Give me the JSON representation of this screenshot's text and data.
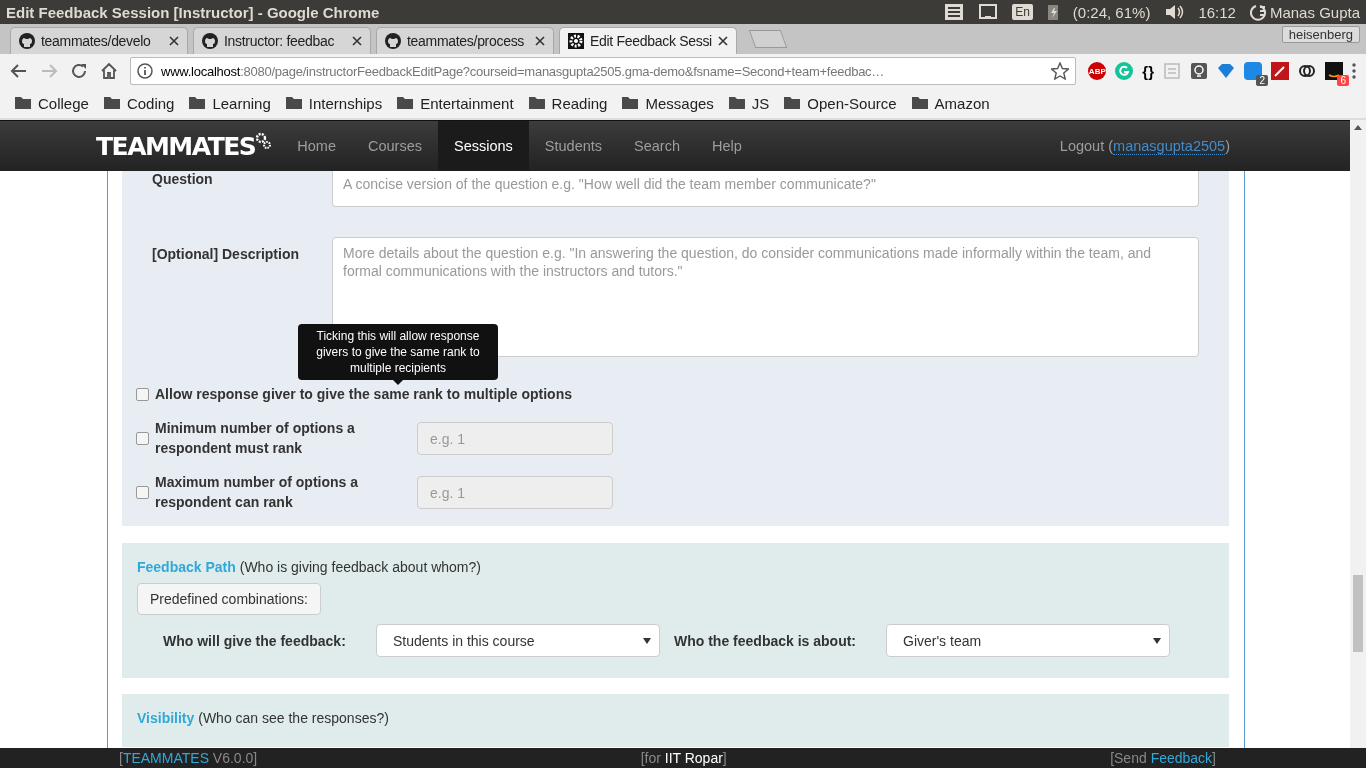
{
  "os_bar": {
    "title": "Edit Feedback Session [Instructor] - Google Chrome",
    "keyboard": "En",
    "battery": "(0:24, 61%)",
    "time": "16:12",
    "user": "Manas Gupta"
  },
  "tabs": [
    {
      "label": "teammates/develo",
      "kind": "github",
      "selected": false
    },
    {
      "label": "Instructor: feedbac",
      "kind": "github",
      "selected": false
    },
    {
      "label": "teammates/process",
      "kind": "github",
      "selected": false
    },
    {
      "label": "Edit Feedback Sessi",
      "kind": "gear",
      "selected": true
    }
  ],
  "profile": "heisenberg",
  "address": {
    "host": "www.localhost",
    "rest": ":8080/page/instructorFeedbackEditPage?courseid=manasgupta2505.gma-demo&fsname=Second+team+feedbac…"
  },
  "extensions": [
    {
      "kind": "abp",
      "label": "ABP"
    },
    {
      "kind": "grammarly"
    },
    {
      "kind": "braces",
      "label": "{}"
    },
    {
      "kind": "reader"
    },
    {
      "kind": "bulb"
    },
    {
      "kind": "diamond"
    },
    {
      "kind": "skype",
      "badge": "2"
    },
    {
      "kind": "wand"
    },
    {
      "kind": "link"
    },
    {
      "kind": "amazon",
      "badge": "6"
    }
  ],
  "bookmarks": [
    "College",
    "Coding",
    "Learning",
    "Internships",
    "Entertainment",
    "Reading",
    "Messages",
    "JS",
    "Open-Source",
    "Amazon"
  ],
  "navbar": {
    "brand": "TEAMMATES",
    "items": [
      {
        "label": "Home",
        "selected": false
      },
      {
        "label": "Courses",
        "selected": false
      },
      {
        "label": "Sessions",
        "selected": true
      },
      {
        "label": "Students",
        "selected": false
      },
      {
        "label": "Search",
        "selected": false
      },
      {
        "label": "Help",
        "selected": false
      }
    ],
    "logout": "Logout (",
    "user": "manasgupta2505",
    "close": ")"
  },
  "question": {
    "summary_label": "Question",
    "summary_placeholder": "A concise version of the question e.g. \"How well did the team member communicate?\"",
    "description_label": "[Optional] Description",
    "description_placeholder": "More details about the question e.g. \"In answering the question, do consider communications made informally within the team, and formal communications with the instructors and tutors.\"",
    "tooltip": "Ticking this will allow response givers to give the same rank to multiple recipients",
    "options": [
      {
        "label": "Allow response giver to give the same rank to multiple options",
        "checked": false
      },
      {
        "label": "Minimum number of options a respondent must rank",
        "checked": false,
        "placeholder": "e.g. 1"
      },
      {
        "label": "Maximum number of options a respondent can rank",
        "checked": false,
        "placeholder": "e.g. 1"
      }
    ]
  },
  "feedback_path": {
    "title": "Feedback Path",
    "subtitle": "(Who is giving feedback about whom?)",
    "button": "Predefined combinations:",
    "giver_label": "Who will give the feedback:",
    "giver": "Students in this course",
    "recipient_label": "Who the feedback is about:",
    "recipient": "Giver's team"
  },
  "visibility": {
    "title": "Visibility",
    "subtitle": "(Who can see the responses?)"
  },
  "footer": [
    [
      {
        "text": "[",
        "kind": "plain"
      },
      {
        "text": "TEAMMATES",
        "kind": "link"
      },
      {
        "text": " V6.0.0]",
        "kind": "plain"
      }
    ],
    [
      {
        "text": "[for ",
        "kind": "plain"
      },
      {
        "text": "IIT Ropar",
        "kind": "bright"
      },
      {
        "text": "]",
        "kind": "plain"
      }
    ],
    [
      {
        "text": "[Send ",
        "kind": "plain"
      },
      {
        "text": "Feedback",
        "kind": "link"
      },
      {
        "text": "]",
        "kind": "plain"
      }
    ]
  ]
}
